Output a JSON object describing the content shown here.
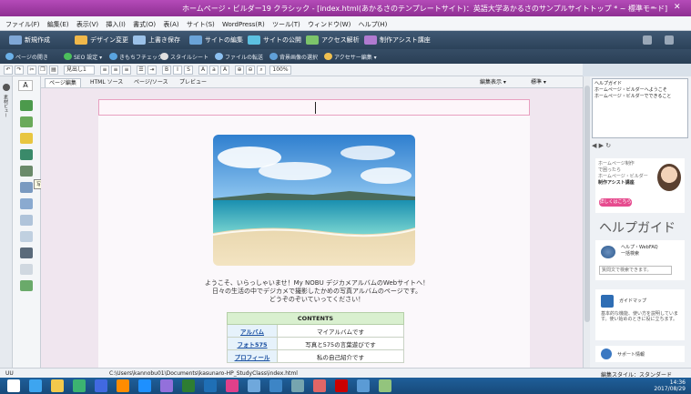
{
  "window": {
    "title": "ホームページ・ビルダー19 クラシック - [index.html(あかるさのテンプレートサイト)：英語大学あかるさのサンプルサイトトップ * ~ 標準モード]",
    "minimize": "–",
    "close": "✕"
  },
  "menu": [
    "ファイル(F)",
    "編集(E)",
    "表示(V)",
    "挿入(I)",
    "書式(O)",
    "表(A)",
    "サイト(S)",
    "WordPress(R)",
    "ツール(T)",
    "ウィンドウ(W)",
    "ヘルプ(H)"
  ],
  "toolbar_main": [
    {
      "label": "新規作成",
      "color": "#7fa7d6"
    },
    {
      "label": "デザイン変更",
      "color": "#f0b84a"
    },
    {
      "label": "上書き保存",
      "color": "#9bc1e8"
    },
    {
      "label": "サイトの編集",
      "color": "#6aa3d8"
    },
    {
      "label": "サイトの公開",
      "color": "#5cc0e0"
    },
    {
      "label": "アクセス解析",
      "color": "#7cc46a"
    },
    {
      "label": "制作アシスト講座",
      "color": "#b07ad0"
    }
  ],
  "toolbar_sub": [
    {
      "label": "ページの開き",
      "color": "#6bb0e8"
    },
    {
      "label": "SEO 設定 ▾",
      "color": "#4cbf5c"
    },
    {
      "label": "きもちフチェック",
      "color": "#59a4e0"
    },
    {
      "label": "スタイルシート",
      "color": "#e0e0e0"
    },
    {
      "label": "ファイルの転送",
      "color": "#8cc0f0"
    },
    {
      "label": "背景画像の選択",
      "color": "#60a0d8"
    },
    {
      "label": "アクセサー編集 ▾",
      "color": "#f0c050"
    }
  ],
  "format_bar": {
    "style_select": "見出し1",
    "zoom": "100%"
  },
  "tabs": [
    "ページ編集",
    "HTML ソース",
    "ページ/ソース",
    "プレビュー"
  ],
  "tab_right": [
    "編集表示 ▾",
    "標準 ▾"
  ],
  "left_panel": {
    "vertical_label": "素材ビュー",
    "tooltip": "写真や画像の挿入"
  },
  "document": {
    "welcome_line1": "ようこそ、いらっしゃいませ！My NOBU デジカメアルバムのWebサイトへ！",
    "welcome_line2": "日々の生活の中でデジカメで撮影したかめの写真アルバムのページです。",
    "welcome_line3": "どうぞのぞいていってください！",
    "contents": {
      "header": "CONTENTS",
      "rows": [
        {
          "link": "アルバム",
          "desc": "マイアルバムです"
        },
        {
          "link": "フォト575",
          "desc": "写真と575の言葉遊びです"
        },
        {
          "link": "プロフィール",
          "desc": "私の自己紹介です"
        }
      ]
    }
  },
  "right_panel": {
    "top_title": "ヘルプガイド",
    "top_items": [
      "ホームページ・ビルダーへようこそ",
      "ホームページ・ビルダーでできること"
    ],
    "ad_text1": "ホームページ制作",
    "ad_text2": "で困ったら",
    "ad_text3": "ホームページ・ビルダー",
    "ad_title": "制作アシスト講座",
    "ad_button": "詳しくはこちら",
    "help_title": "ヘルプガイド",
    "faq_title": "ヘルプ・WebFAQ",
    "faq_sub": "一括検索",
    "faq_box": "質問文で検索できます。",
    "map_title": "ガイドマップ",
    "map_desc": "基本的な機能、使い方を説明しています。使い始めのときに役に立ちます。",
    "support_title": "サポート情報"
  },
  "statusbar": {
    "mode": "UU",
    "path": "C:\\Users\\kannobu01\\Documents\\kasunaro-HP_StudyClass\\index.html",
    "right": "編集スタイル：スタンダード"
  },
  "clock": {
    "time": "14:36",
    "date": "2017/08/29"
  },
  "taskbar_icons": [
    {
      "name": "start",
      "color": "#ffffff"
    },
    {
      "name": "ie",
      "color": "#3da5f0"
    },
    {
      "name": "explorer",
      "color": "#f2c94c"
    },
    {
      "name": "app-green",
      "color": "#3cb371"
    },
    {
      "name": "app-blue",
      "color": "#4169e1"
    },
    {
      "name": "app-orange",
      "color": "#ff8c00"
    },
    {
      "name": "media",
      "color": "#1e90ff"
    },
    {
      "name": "photo",
      "color": "#9370db"
    },
    {
      "name": "dreamweaver",
      "color": "#2e7d32"
    },
    {
      "name": "photoshop",
      "color": "#1f6fb5"
    },
    {
      "name": "hpb",
      "color": "#e0408a"
    },
    {
      "name": "app7",
      "color": "#6fa8dc"
    },
    {
      "name": "app8",
      "color": "#3d85c6"
    },
    {
      "name": "app9",
      "color": "#76a5af"
    },
    {
      "name": "app10",
      "color": "#e06666"
    },
    {
      "name": "app11",
      "color": "#cc0000"
    },
    {
      "name": "app12",
      "color": "#5b9bd5"
    },
    {
      "name": "app13",
      "color": "#93c47d"
    }
  ]
}
